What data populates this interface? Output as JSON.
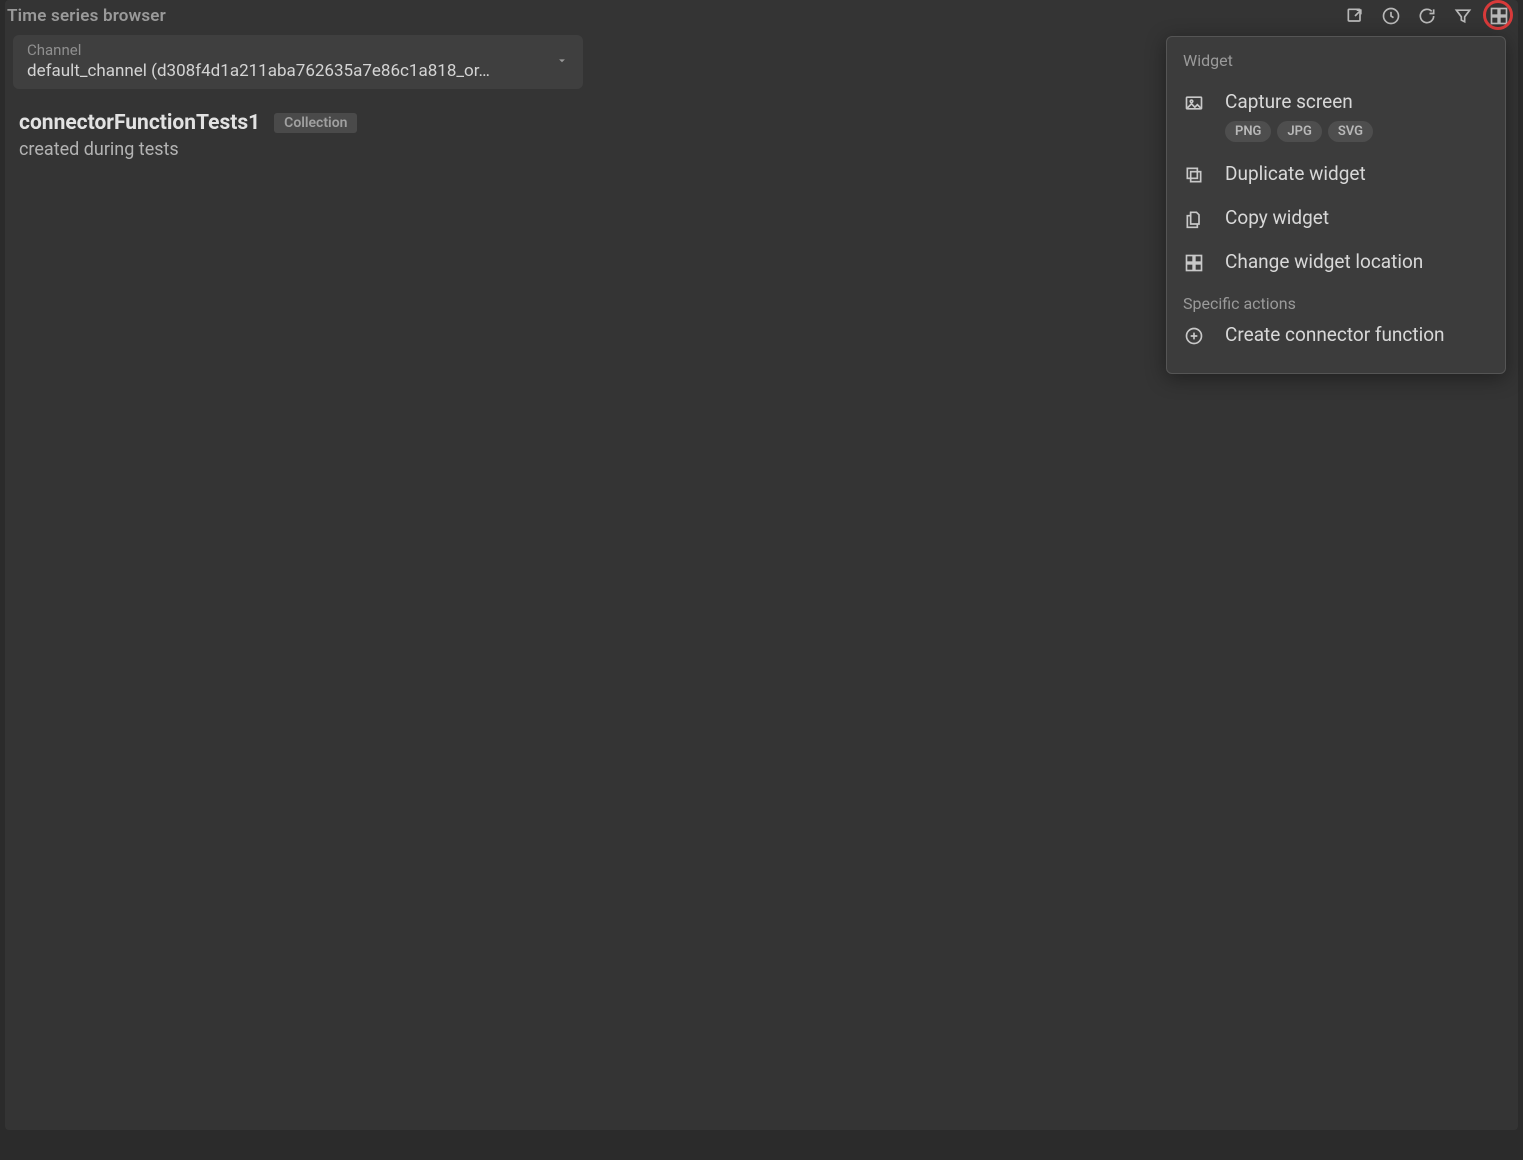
{
  "header": {
    "title": "Time series browser"
  },
  "channel": {
    "label": "Channel",
    "value": "default_channel (d308f4d1a211aba762635a7e86c1a818_or…"
  },
  "item": {
    "name": "connectorFunctionTests1",
    "badge": "Collection",
    "description": "created during tests"
  },
  "menu": {
    "section_widget": "Widget",
    "capture_label": "Capture screen",
    "capture_formats": [
      "PNG",
      "JPG",
      "SVG"
    ],
    "duplicate_label": "Duplicate widget",
    "copy_label": "Copy widget",
    "change_location_label": "Change widget location",
    "section_specific": "Specific actions",
    "create_connector_label": "Create connector function"
  }
}
